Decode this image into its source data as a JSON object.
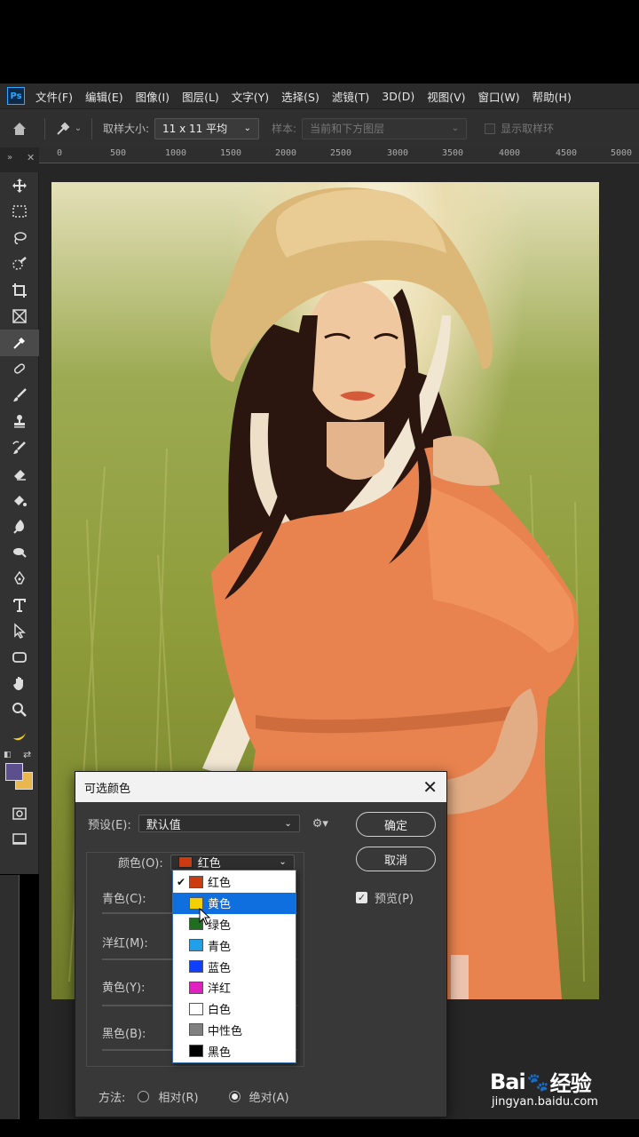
{
  "app": {
    "logo_text": "Ps"
  },
  "menu": [
    "文件(F)",
    "编辑(E)",
    "图像(I)",
    "图层(L)",
    "文字(Y)",
    "选择(S)",
    "滤镜(T)",
    "3D(D)",
    "视图(V)",
    "窗口(W)",
    "帮助(H)"
  ],
  "options": {
    "sample_size_label": "取样大小:",
    "sample_size_value": "11 x 11 平均",
    "sample_label": "样本:",
    "sample_value": "当前和下方图层",
    "show_ring_label": "显示取样环"
  },
  "ruler": {
    "ticks": [
      "0",
      "500",
      "1000",
      "1500",
      "2000",
      "2500",
      "3000",
      "3500",
      "4000",
      "4500",
      "5000"
    ]
  },
  "tools": [
    "move-icon",
    "marquee-icon",
    "lasso-icon",
    "quick-select-icon",
    "crop-icon",
    "frame-icon",
    "eyedropper-icon",
    "healing-icon",
    "brush-icon",
    "stamp-icon",
    "history-brush-icon",
    "eraser-icon",
    "gradient-icon",
    "blur-icon",
    "dodge-icon",
    "pen-icon",
    "type-icon",
    "path-select-icon",
    "shape-icon",
    "hand-icon",
    "zoom-icon",
    "banana-icon"
  ],
  "colors": {
    "foreground": "#5c4f8e",
    "background": "#e8b84f",
    "accent": "#0f6fde"
  },
  "dialog": {
    "title": "可选颜色",
    "preset_label": "预设(E):",
    "preset_value": "默认值",
    "colors_label": "颜色(O):",
    "colors_value": "红色",
    "colors_value_swatch": "#cc3a10",
    "ok_label": "确定",
    "cancel_label": "取消",
    "preview_label": "预览(P)",
    "sliders": [
      "青色(C):",
      "洋红(M):",
      "黄色(Y):",
      "黑色(B):"
    ],
    "method_label": "方法:",
    "relative_label": "相对(R)",
    "absolute_label": "绝对(A)"
  },
  "dropdown": [
    {
      "label": "红色",
      "color": "#cc3a10",
      "checked": true
    },
    {
      "label": "黄色",
      "color": "#f5d000",
      "selected": true
    },
    {
      "label": "绿色",
      "color": "#1f6e1f"
    },
    {
      "label": "青色",
      "color": "#1fa0e8"
    },
    {
      "label": "蓝色",
      "color": "#1040ff"
    },
    {
      "label": "洋红",
      "color": "#e020c0"
    },
    {
      "label": "白色",
      "color": "#ffffff"
    },
    {
      "label": "中性色",
      "color": "#808080"
    },
    {
      "label": "黑色",
      "color": "#000000"
    }
  ],
  "watermark": {
    "logo_a": "Bai",
    "logo_b": "经验",
    "sub": "jingyan.baidu.com"
  }
}
